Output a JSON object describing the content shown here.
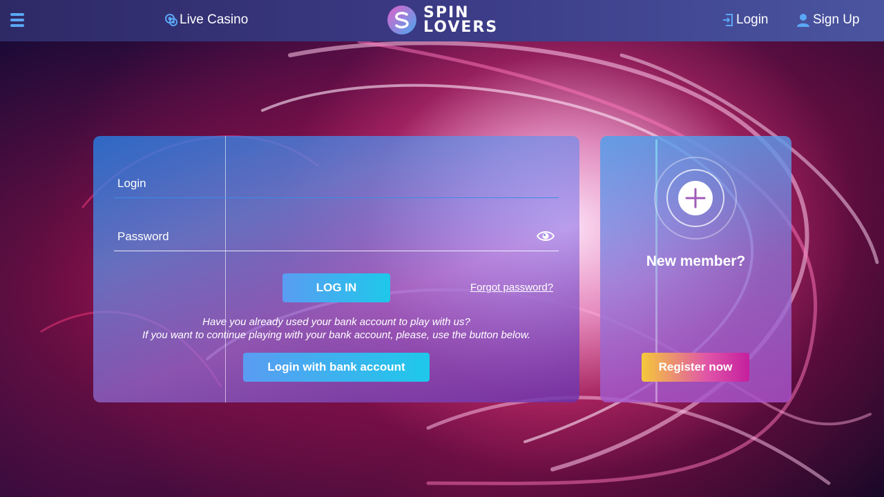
{
  "header": {
    "live_casino": "Live Casino",
    "logo_line1": "SPIN",
    "logo_line2": "LOVERS",
    "login": "Login",
    "signup": "Sign Up"
  },
  "login_form": {
    "login_label": "Login",
    "login_value": "",
    "password_label": "Password",
    "password_value": "",
    "submit_label": "LOG IN",
    "forgot_label": "Forgot password?",
    "note_line1": "Have you already used your bank account to play with us?",
    "note_line2": "If you want to continue playing with your bank account, please, use the button below.",
    "bank_button_label": "Login with bank account"
  },
  "register": {
    "title": "New member?",
    "button_label": "Register now"
  },
  "colors": {
    "header_bg": "#3b3a85",
    "accent_blue": "#1ec8ea",
    "accent_pink": "#c51f9e",
    "accent_yellow": "#f5c93a"
  },
  "icons": {
    "menu": "hamburger-icon",
    "live_casino": "chips-icon",
    "login": "login-door-icon",
    "signup": "user-icon",
    "password_toggle": "eye-icon",
    "register": "plus-icon"
  }
}
